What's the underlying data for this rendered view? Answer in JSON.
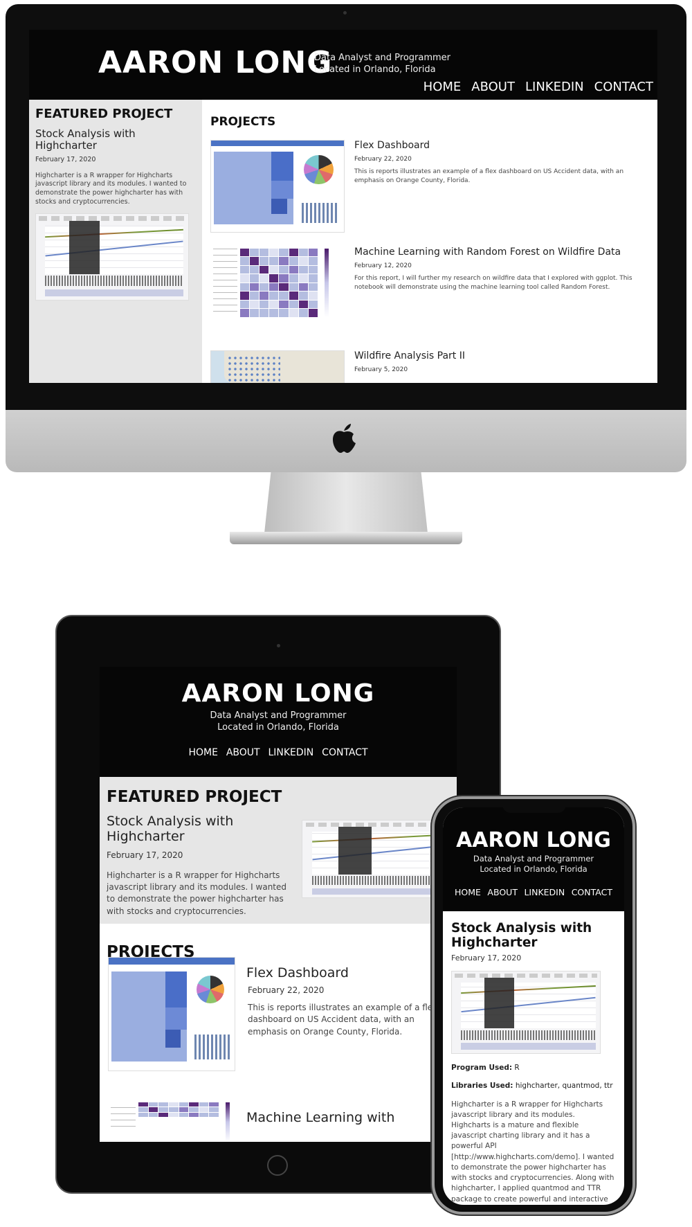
{
  "site": {
    "name": "AARON LONG",
    "tagline_line1": "Data Analyst and Programmer",
    "tagline_line2": "Located in Orlando, Florida",
    "nav": [
      "HOME",
      "ABOUT",
      "LINKEDIN",
      "CONTACT"
    ]
  },
  "featured": {
    "heading": "FEATURED PROJECT",
    "title": "Stock Analysis with Highcharter",
    "date": "February 17, 2020",
    "description": "Highcharter is a R wrapper for Highcharts javascript library and its modules. I wanted to demonstrate the power highcharter has with stocks and cryptocurrencies."
  },
  "projects": {
    "heading": "PROJECTS",
    "items": [
      {
        "title": "Flex Dashboard",
        "date": "February 22, 2020",
        "description": "This is reports illustrates an example of a flex dashboard on US Accident data, with an emphasis on Orange County, Florida."
      },
      {
        "title": "Machine Learning with Random Forest on Wildfire Data",
        "date": "February 12, 2020",
        "description": "For this report, I will further my research on wildfire data that I explored with ggplot. This notebook will demonstrate using the machine learning tool called Random Forest."
      },
      {
        "title": "Wildfire Analysis Part II",
        "date": "February 5, 2020",
        "description": ""
      }
    ],
    "ipad_truncated_title": "Machine Learning with"
  },
  "phone_article": {
    "title": "Stock Analysis with Highcharter",
    "date": "February 17, 2020",
    "program_label": "Program Used:",
    "program_value": "R",
    "libraries_label": "Libraries Used:",
    "libraries_value": "highcharter, quantmod, ttr",
    "body": "Highcharter is a R wrapper for Highcharts javascript library and its modules. Highcharts is a mature and flexible javascript charting library and it has a powerful API [http://www.highcharts.com/demo]. I wanted to demonstrate the power highcharter has with stocks and cryptocurrencies. Along with highcharter, I applied quantmod and TTR package to create powerful and interactive technical charts."
  },
  "icons": {
    "device_logo": "apple-logo-icon"
  },
  "colors": {
    "header_bg": "#060606",
    "sidebar_bg": "#e6e6e6",
    "text": "#222222"
  }
}
